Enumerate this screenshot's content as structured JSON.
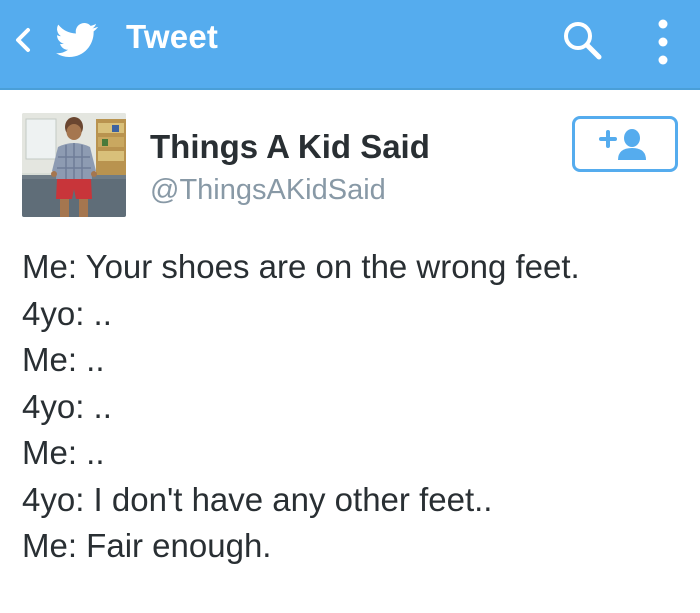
{
  "topbar": {
    "title": "Tweet",
    "back_icon": "chevron-left-icon",
    "logo_icon": "twitter-bird-icon",
    "search_icon": "search-icon",
    "more_icon": "vertical-dots-icon",
    "color": "#55acee"
  },
  "tweet": {
    "display_name": "Things A Kid Said",
    "handle": "@ThingsAKidSaid",
    "follow_icon": "add-user-icon",
    "lines": [
      "Me: Your shoes are on the wrong feet.",
      "4yo: ..",
      "Me: ..",
      "4yo: ..",
      "Me: ..",
      "4yo: I don't have any other feet..",
      "Me: Fair enough."
    ]
  },
  "colors": {
    "accent": "#55acee",
    "text": "#292f33",
    "muted": "#8899a6"
  }
}
